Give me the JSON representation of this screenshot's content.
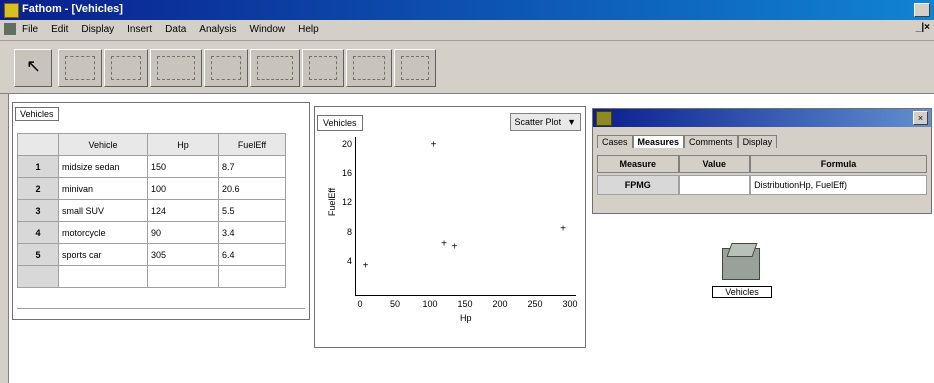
{
  "window": {
    "title": "Fathom - [Vehicles]"
  },
  "menu": {
    "items": [
      "File",
      "Edit",
      "Display",
      "Insert",
      "Data",
      "Analysis",
      "Window",
      "Help"
    ],
    "right_glyph": "_|×"
  },
  "table": {
    "title": "Vehicles",
    "columns": [
      "Vehicle",
      "Hp",
      "FuelEff"
    ],
    "rows": [
      {
        "n": "1",
        "vehicle": "midsize sedan",
        "hp": "150",
        "fuel": "8.7"
      },
      {
        "n": "2",
        "vehicle": "minivan",
        "hp": "100",
        "fuel": "20.6"
      },
      {
        "n": "3",
        "vehicle": "small SUV",
        "hp": "124",
        "fuel": "5.5"
      },
      {
        "n": "4",
        "vehicle": "motorcycle",
        "hp": "90",
        "fuel": "3.4"
      },
      {
        "n": "5",
        "vehicle": "sports car",
        "hp": "305",
        "fuel": "6.4"
      }
    ]
  },
  "graph": {
    "title": "Vehicles",
    "popup": "Scatter Plot",
    "popup_arrow": "▼",
    "xlabel": "Hp",
    "ylabel": "FuelEff",
    "marker": "+"
  },
  "chart_data": {
    "type": "scatter",
    "title": "Vehicles",
    "xlabel": "Hp",
    "ylabel": "FuelEff",
    "xlim": [
      0,
      300
    ],
    "ylim": [
      0,
      20
    ],
    "xticks": [
      "0",
      "50",
      "100",
      "150",
      "200",
      "250",
      "300"
    ],
    "yticks": [
      "4",
      "8",
      "12",
      "16",
      "20"
    ],
    "points": [
      {
        "x": 8,
        "y": 3.4
      },
      {
        "x": 105,
        "y": 20
      },
      {
        "x": 120,
        "y": 6.5
      },
      {
        "x": 135,
        "y": 6
      },
      {
        "x": 290,
        "y": 8.5
      }
    ]
  },
  "inspector": {
    "tabs": [
      "Cases",
      "Measures",
      "Comments",
      "Display"
    ],
    "active_tab": "Measures",
    "columns": [
      "Measure",
      "Value",
      "Formula"
    ],
    "row": {
      "measure": "FPMG",
      "value": "",
      "formula": "DistributionHp, FuelEff)"
    }
  },
  "collection": {
    "label": "Vehicles"
  }
}
